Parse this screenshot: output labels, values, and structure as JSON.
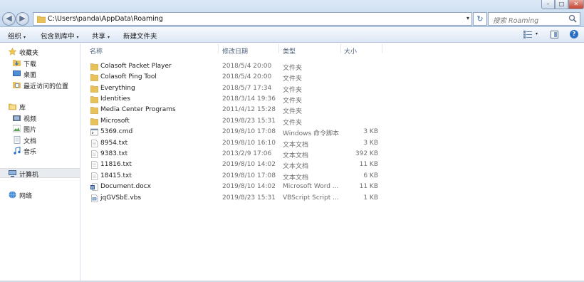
{
  "window": {
    "address_path": "C:\\Users\\panda\\AppData\\Roaming",
    "search_placeholder": "搜索 Roaming",
    "min_glyph": "–",
    "max_glyph": "□",
    "close_glyph": "✕",
    "back_glyph": "◀",
    "forward_glyph": "▶",
    "refresh_glyph": "↻",
    "address_dropdown": "▾"
  },
  "toolbar": {
    "organize": "组织",
    "include_in_library": "包含到库中",
    "share": "共享",
    "new_folder": "新建文件夹",
    "caret": "▾",
    "help": "?"
  },
  "nav": {
    "favorites": "收藏夹",
    "downloads": "下载",
    "desktop": "桌面",
    "recent": "最近访问的位置",
    "libraries": "库",
    "videos": "视频",
    "pictures": "图片",
    "documents": "文档",
    "music": "音乐",
    "computer": "计算机",
    "network": "网络"
  },
  "columns": {
    "name": "名称",
    "modified": "修改日期",
    "type": "类型",
    "size": "大小"
  },
  "files": [
    {
      "name": "Colasoft Packet Player",
      "modified": "2018/5/4 20:00",
      "type": "文件夹",
      "size": "",
      "icon": "folder-icon"
    },
    {
      "name": "Colasoft Ping Tool",
      "modified": "2018/5/4 20:00",
      "type": "文件夹",
      "size": "",
      "icon": "folder-icon"
    },
    {
      "name": "Everything",
      "modified": "2018/5/7 17:34",
      "type": "文件夹",
      "size": "",
      "icon": "folder-icon"
    },
    {
      "name": "Identities",
      "modified": "2018/3/14 19:36",
      "type": "文件夹",
      "size": "",
      "icon": "folder-icon"
    },
    {
      "name": "Media Center Programs",
      "modified": "2011/4/12 15:28",
      "type": "文件夹",
      "size": "",
      "icon": "folder-icon"
    },
    {
      "name": "Microsoft",
      "modified": "2019/8/23 15:31",
      "type": "文件夹",
      "size": "",
      "icon": "folder-icon"
    },
    {
      "name": "5369.cmd",
      "modified": "2019/8/10 17:08",
      "type": "Windows 命令脚本",
      "size": "3 KB",
      "icon": "cmd-file-icon"
    },
    {
      "name": "8954.txt",
      "modified": "2019/8/10 16:10",
      "type": "文本文档",
      "size": "3 KB",
      "icon": "text-file-icon"
    },
    {
      "name": "9383.txt",
      "modified": "2013/2/9 17:06",
      "type": "文本文档",
      "size": "392 KB",
      "icon": "text-file-icon"
    },
    {
      "name": "11816.txt",
      "modified": "2019/8/10 14:02",
      "type": "文本文档",
      "size": "11 KB",
      "icon": "text-file-icon"
    },
    {
      "name": "18415.txt",
      "modified": "2019/8/10 17:08",
      "type": "文本文档",
      "size": "6 KB",
      "icon": "text-file-icon"
    },
    {
      "name": "Document.docx",
      "modified": "2019/8/10 14:02",
      "type": "Microsoft Word ...",
      "size": "11 KB",
      "icon": "word-file-icon"
    },
    {
      "name": "jqGVSbE.vbs",
      "modified": "2019/8/23 15:31",
      "type": "VBScript Script ...",
      "size": "1 KB",
      "icon": "vbs-file-icon"
    }
  ],
  "colors": {
    "folder": "#e8c15a",
    "accent": "#2d6fc2"
  }
}
